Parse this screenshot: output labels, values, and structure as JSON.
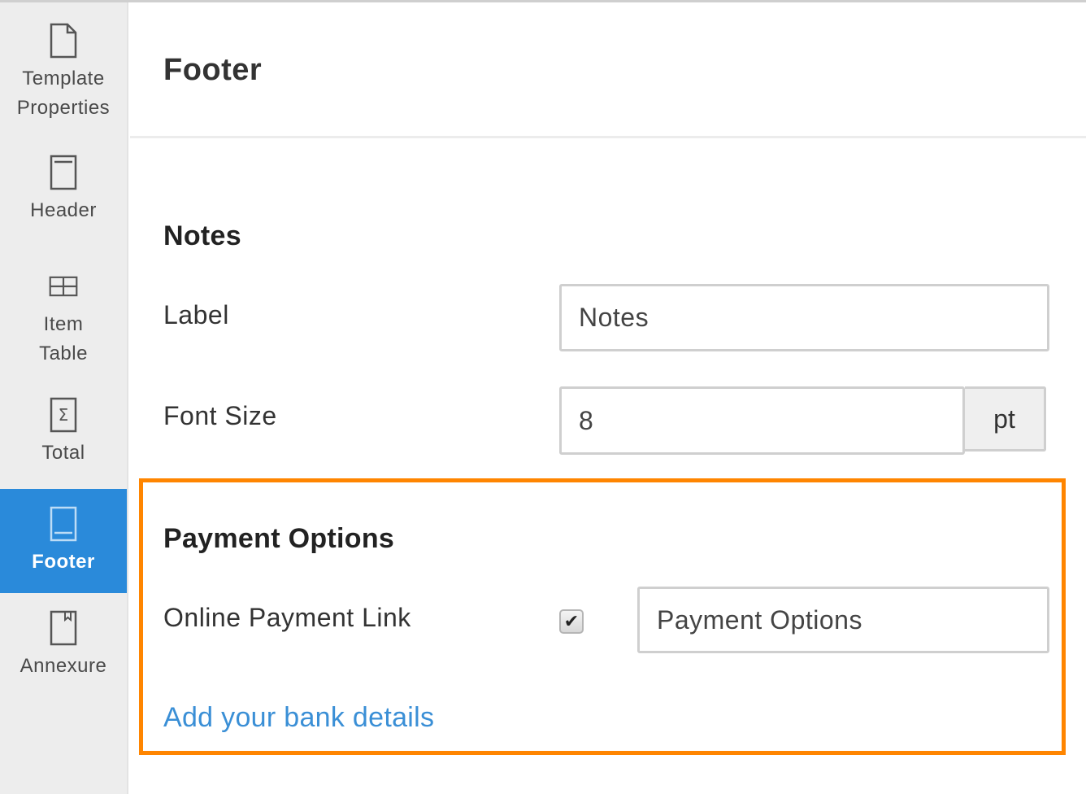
{
  "sidebar": {
    "items": [
      {
        "label_line1": "Template",
        "label_line2": "Properties",
        "icon": "document-icon"
      },
      {
        "label": "Header",
        "icon": "header-icon"
      },
      {
        "label_line1": "Item",
        "label_line2": "Table",
        "icon": "table-icon"
      },
      {
        "label": "Total",
        "icon": "sigma-icon"
      },
      {
        "label": "Footer",
        "icon": "footer-icon",
        "active": true
      },
      {
        "label": "Annexure",
        "icon": "bookmark-page-icon"
      }
    ],
    "active_color": "#2a8ada"
  },
  "page": {
    "title": "Footer"
  },
  "notes": {
    "heading": "Notes",
    "label_field": {
      "label": "Label",
      "value": "Notes"
    },
    "font_size_field": {
      "label": "Font Size",
      "value": "8",
      "unit": "pt"
    }
  },
  "payment_options": {
    "heading": "Payment Options",
    "online_payment_link": {
      "label": "Online Payment Link",
      "checked": true,
      "value": "Payment Options"
    },
    "bank_details_link": "Add your bank details"
  },
  "highlight_color": "#ff8500"
}
